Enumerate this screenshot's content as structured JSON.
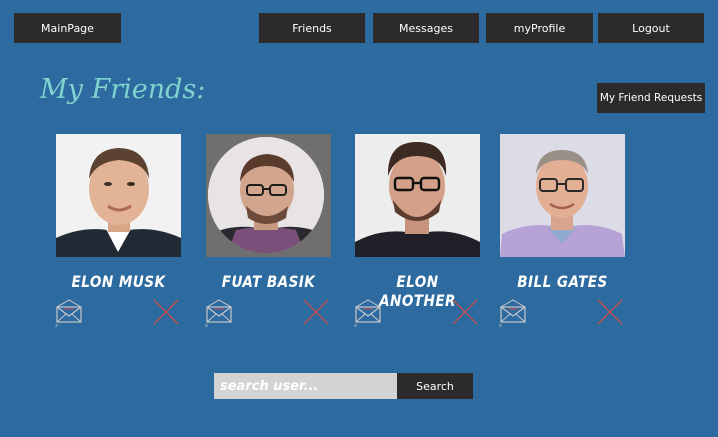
{
  "nav": {
    "main": "MainPage",
    "friends": "Friends",
    "messages": "Messages",
    "profile": "myProfile",
    "logout": "Logout"
  },
  "page_title": "My Friends:",
  "requests_button": "My Friend Requests",
  "friends": [
    {
      "name": "ELON MUSK"
    },
    {
      "name": "FUAT BASIK"
    },
    {
      "name": "ELON ANOTHER"
    },
    {
      "name": "BILL GATES"
    }
  ],
  "search": {
    "placeholder": "search user...",
    "button": "Search"
  },
  "icons": {
    "message": "envelope-icon",
    "remove": "remove-x-icon"
  },
  "colors": {
    "background": "#2c6aa0",
    "button": "#2d2a2b",
    "title": "#7fd3cf",
    "remove": "#c0504d"
  }
}
